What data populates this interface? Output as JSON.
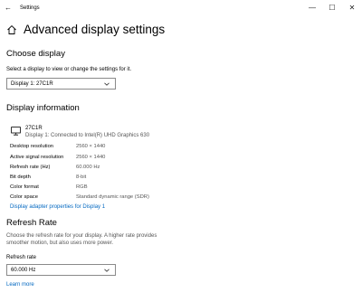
{
  "titlebar": {
    "back_glyph": "←",
    "title": "Settings",
    "minimize_glyph": "—",
    "maximize_glyph": "☐",
    "close_glyph": "✕"
  },
  "page": {
    "title": "Advanced display settings"
  },
  "choose_display": {
    "heading": "Choose display",
    "description": "Select a display to view or change the settings for it.",
    "selected": "Display 1: 27C1R"
  },
  "display_info": {
    "heading": "Display information",
    "monitor_name": "27C1R",
    "connection": "Display 1: Connected to Intel(R) UHD Graphics 630",
    "rows": [
      {
        "label": "Desktop resolution",
        "value": "2560 × 1440"
      },
      {
        "label": "Active signal resolution",
        "value": "2560 × 1440"
      },
      {
        "label": "Refresh rate (Hz)",
        "value": "60.000 Hz"
      },
      {
        "label": "Bit depth",
        "value": "8-bit"
      },
      {
        "label": "Color format",
        "value": "RGB"
      },
      {
        "label": "Color space",
        "value": "Standard dynamic range (SDR)"
      }
    ],
    "adapter_link": "Display adapter properties for Display 1"
  },
  "refresh_rate": {
    "heading": "Refresh Rate",
    "description_line1": "Choose the refresh rate for your display. A higher rate provides",
    "description_line2": "smoother motion, but also uses more power.",
    "field_label": "Refresh rate",
    "selected": "60.000 Hz",
    "learn_more": "Learn more"
  },
  "colors": {
    "accent": "#0067c0"
  }
}
